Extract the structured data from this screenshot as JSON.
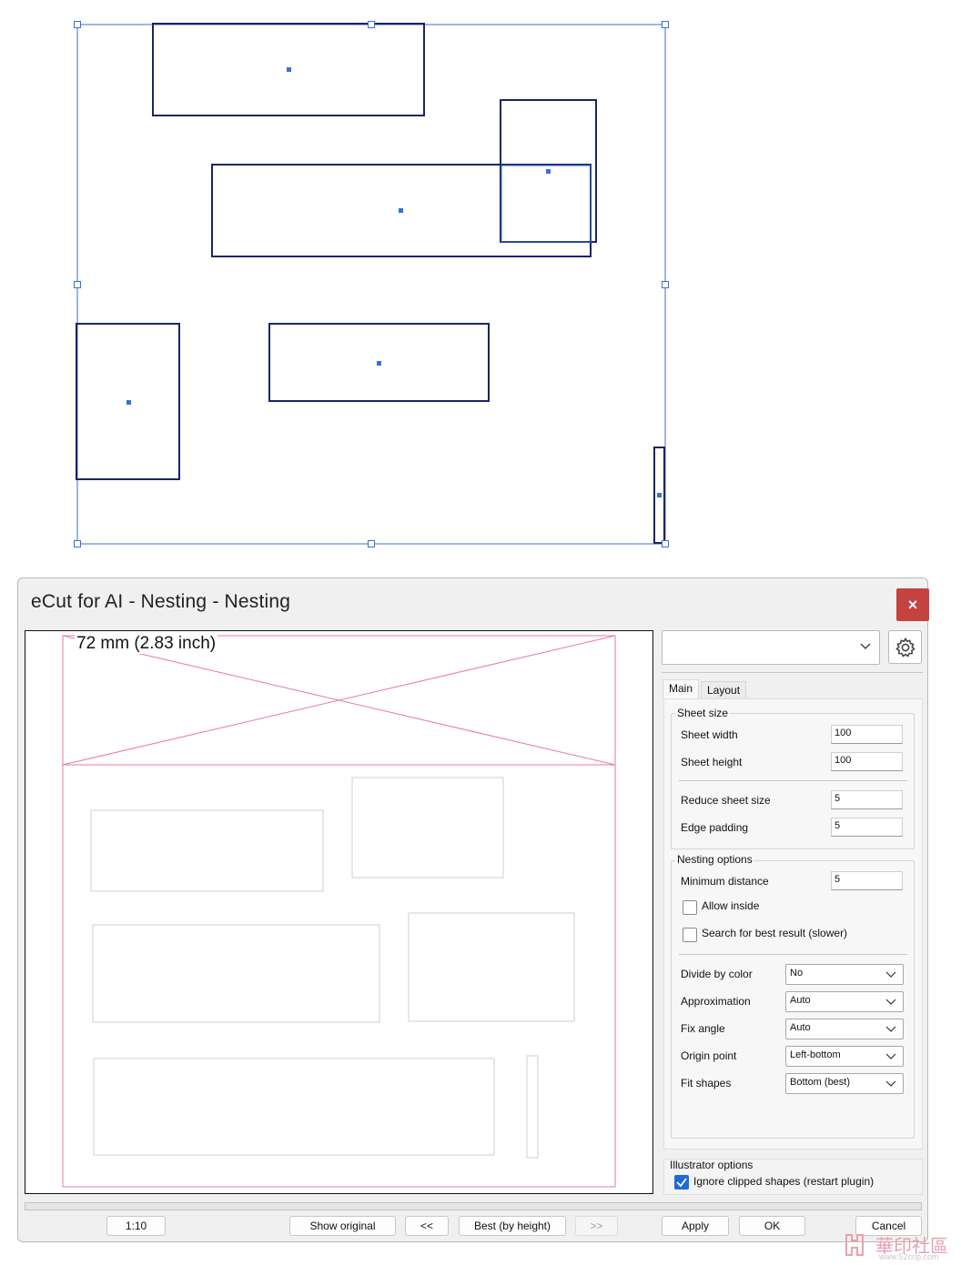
{
  "dialog": {
    "title": "eCut for AI - Nesting - Nesting",
    "close_label": "×",
    "preview_label": "72 mm (2.83 inch)",
    "preset_value": ""
  },
  "tabs": [
    {
      "label": "Main",
      "active": true
    },
    {
      "label": "Layout",
      "active": false
    }
  ],
  "sheet_size": {
    "group_title": "Sheet size",
    "fields": [
      {
        "label": "Sheet width",
        "value": "100"
      },
      {
        "label": "Sheet height",
        "value": "100"
      },
      {
        "label": "Reduce sheet size",
        "value": "5"
      },
      {
        "label": "Edge padding",
        "value": "5"
      }
    ]
  },
  "nesting_options": {
    "group_title": "Nesting options",
    "min_distance": {
      "label": "Minimum distance",
      "value": "5"
    },
    "allow_inside": {
      "label": "Allow inside",
      "checked": false
    },
    "search_best": {
      "label": "Search for best result (slower)",
      "checked": false
    },
    "combos": [
      {
        "label": "Divide by color",
        "value": "No"
      },
      {
        "label": "Approximation",
        "value": "Auto"
      },
      {
        "label": "Fix angle",
        "value": "Auto"
      },
      {
        "label": "Origin point",
        "value": "Left-bottom"
      },
      {
        "label": "Fit shapes",
        "value": "Bottom (best)"
      }
    ]
  },
  "illustrator_options": {
    "group_title": "Illustrator options",
    "ignore_clipped": {
      "label": "Ignore clipped shapes (restart plugin)",
      "checked": true
    }
  },
  "buttons": {
    "scale": "1:10",
    "show_original": "Show original",
    "prev": "<<",
    "best": "Best (by height)",
    "next": ">>",
    "apply": "Apply",
    "ok": "OK",
    "cancel": "Cancel"
  },
  "watermark": {
    "text": "華印社區",
    "url": "www.52cnp.com"
  },
  "colors": {
    "close_button": "#c4423f",
    "shape_stroke": "#1b2466",
    "selection_blue": "#3a6fd8",
    "sheet_pink": "#e87aa0",
    "checkbox_checked": "#1f6bd6"
  }
}
